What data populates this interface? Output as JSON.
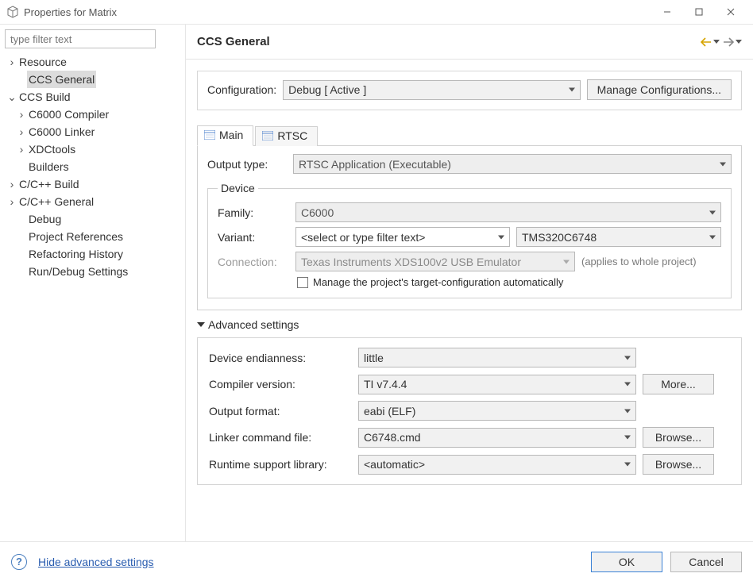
{
  "window": {
    "title": "Properties for Matrix"
  },
  "filter": {
    "placeholder": "type filter text"
  },
  "tree": {
    "items": [
      {
        "label": "Resource",
        "expander": ">",
        "indent": 0
      },
      {
        "label": "CCS General",
        "expander": "",
        "indent": 1,
        "selected": true
      },
      {
        "label": "CCS Build",
        "expander": "v",
        "indent": 0
      },
      {
        "label": "C6000 Compiler",
        "expander": ">",
        "indent": 1
      },
      {
        "label": "C6000 Linker",
        "expander": ">",
        "indent": 1
      },
      {
        "label": "XDCtools",
        "expander": ">",
        "indent": 1
      },
      {
        "label": "Builders",
        "expander": "",
        "indent": 1
      },
      {
        "label": "C/C++ Build",
        "expander": ">",
        "indent": 0
      },
      {
        "label": "C/C++ General",
        "expander": ">",
        "indent": 0
      },
      {
        "label": "Debug",
        "expander": "",
        "indent": 1
      },
      {
        "label": "Project References",
        "expander": "",
        "indent": 1
      },
      {
        "label": "Refactoring History",
        "expander": "",
        "indent": 1
      },
      {
        "label": "Run/Debug Settings",
        "expander": "",
        "indent": 1
      }
    ]
  },
  "header": {
    "title": "CCS General"
  },
  "config": {
    "label": "Configuration:",
    "value": "Debug  [ Active ]",
    "manage_label": "Manage Configurations..."
  },
  "tabs": {
    "main": "Main",
    "rtsc": "RTSC"
  },
  "main": {
    "output_type_label": "Output type:",
    "output_type_value": "RTSC Application (Executable)",
    "device_legend": "Device",
    "family_label": "Family:",
    "family_value": "C6000",
    "variant_label": "Variant:",
    "variant_filter_placeholder": "<select or type filter text>",
    "variant_value": "TMS320C6748",
    "connection_label": "Connection:",
    "connection_value": "Texas Instruments XDS100v2 USB Emulator",
    "connection_hint": "(applies to whole project)",
    "manage_target_label": "Manage the project's target-configuration automatically"
  },
  "advanced": {
    "toggle_label": "Advanced settings",
    "endianness_label": "Device endianness:",
    "endianness_value": "little",
    "compiler_label": "Compiler version:",
    "compiler_value": "TI v7.4.4",
    "more_label": "More...",
    "output_format_label": "Output format:",
    "output_format_value": "eabi (ELF)",
    "linker_label": "Linker command file:",
    "linker_value": "C6748.cmd",
    "runtime_label": "Runtime support library:",
    "runtime_value": "<automatic>",
    "browse_label": "Browse..."
  },
  "footer": {
    "hide_label": "Hide advanced settings",
    "ok_label": "OK",
    "cancel_label": "Cancel"
  }
}
